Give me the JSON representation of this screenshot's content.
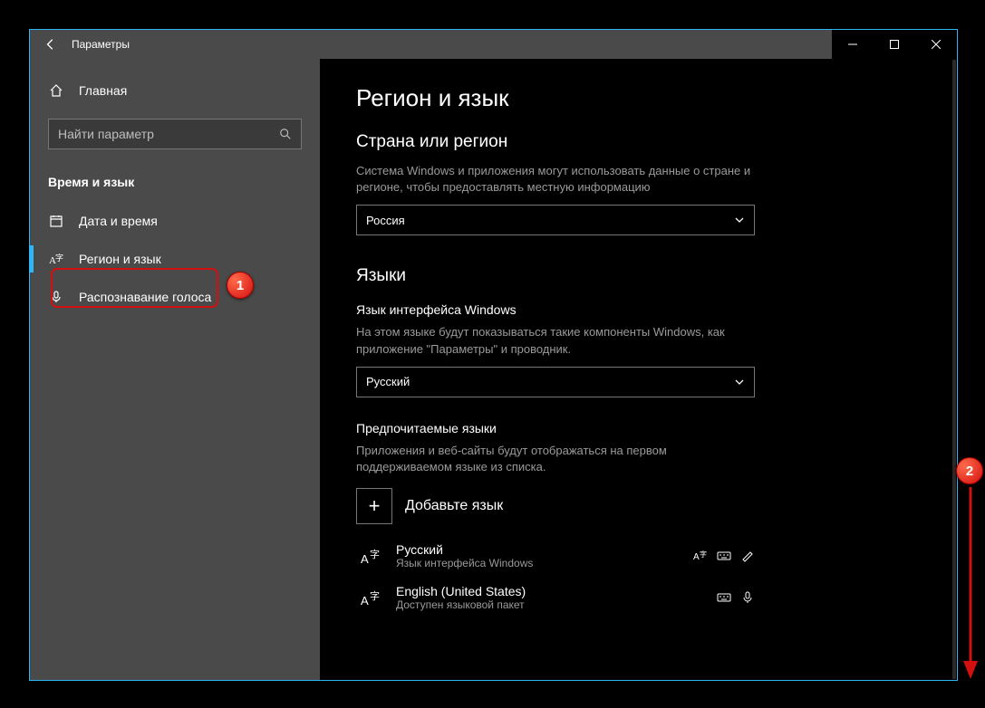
{
  "titlebar": {
    "title": "Параметры"
  },
  "sidebar": {
    "home": "Главная",
    "search_placeholder": "Найти параметр",
    "section": "Время и язык",
    "items": [
      {
        "label": "Дата и время"
      },
      {
        "label": "Регион и язык"
      },
      {
        "label": "Распознавание голоса"
      }
    ]
  },
  "content": {
    "title": "Регион и язык",
    "region": {
      "heading": "Страна или регион",
      "desc": "Система Windows и приложения могут использовать данные о стране и регионе, чтобы предоставлять местную информацию",
      "value": "Россия"
    },
    "languages": {
      "heading": "Языки",
      "display_label": "Язык интерфейса Windows",
      "display_desc": "На этом языке будут показываться такие компоненты Windows, как приложение \"Параметры\" и проводник.",
      "display_value": "Русский",
      "preferred_label": "Предпочитаемые языки",
      "preferred_desc": "Приложения и веб-сайты будут отображаться на первом поддерживаемом языке из списка.",
      "add_label": "Добавьте язык",
      "list": [
        {
          "name": "Русский",
          "sub": "Язык интерфейса Windows",
          "badges": [
            "display",
            "keyboard",
            "handwriting"
          ]
        },
        {
          "name": "English (United States)",
          "sub": "Доступен языковой пакет",
          "badges": [
            "keyboard",
            "voice"
          ]
        }
      ]
    }
  },
  "annotations": {
    "one": "1",
    "two": "2"
  }
}
